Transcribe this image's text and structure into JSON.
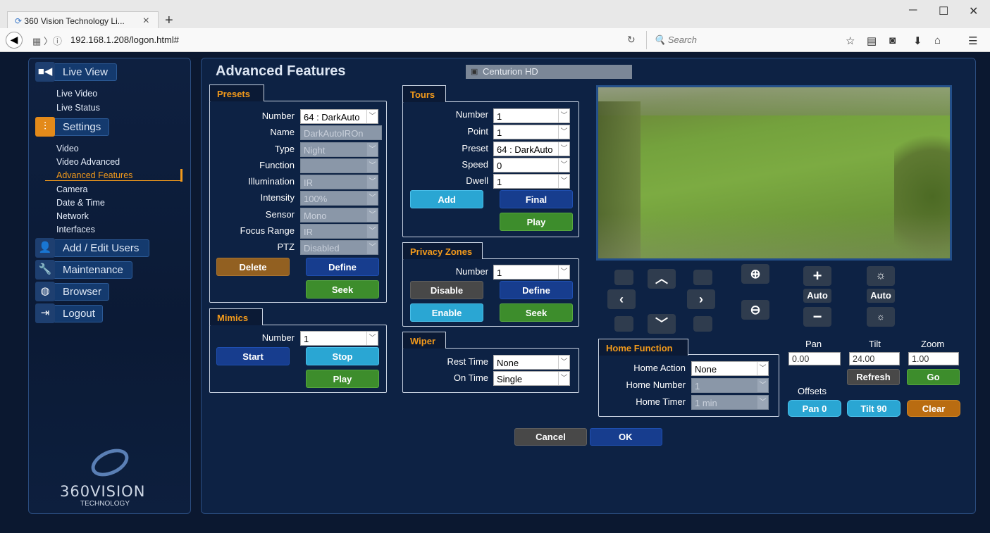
{
  "browser": {
    "tab_title": "360 Vision Technology Li...",
    "url": "192.168.1.208/logon.html#",
    "search_placeholder": "Search"
  },
  "sidebar": {
    "live_view": "Live View",
    "live_links": [
      "Live Video",
      "Live Status"
    ],
    "settings": "Settings",
    "settings_links": [
      "Video",
      "Video Advanced",
      "Advanced Features",
      "Camera",
      "Date & Time",
      "Network",
      "Interfaces"
    ],
    "add_users": "Add / Edit Users",
    "maintenance": "Maintenance",
    "browser": "Browser",
    "logout": "Logout",
    "logo_line1": "360VISION",
    "logo_line2": "TECHNOLOGY"
  },
  "main": {
    "title": "Advanced Features",
    "camera_name": "Centurion HD",
    "presets": {
      "tab": "Presets",
      "number_label": "Number",
      "number": "64 : DarkAuto",
      "name_label": "Name",
      "name": "DarkAutoIROn",
      "type_label": "Type",
      "type": "Night",
      "function_label": "Function",
      "function": "",
      "illumination_label": "Illumination",
      "illumination": "IR",
      "intensity_label": "Intensity",
      "intensity": "100%",
      "sensor_label": "Sensor",
      "sensor": "Mono",
      "focus_label": "Focus Range",
      "focus": "IR",
      "ptz_label": "PTZ",
      "ptz": "Disabled",
      "delete": "Delete",
      "define": "Define",
      "seek": "Seek"
    },
    "mimics": {
      "tab": "Mimics",
      "number_label": "Number",
      "number": "1",
      "start": "Start",
      "stop": "Stop",
      "play": "Play"
    },
    "tours": {
      "tab": "Tours",
      "number_label": "Number",
      "number": "1",
      "point_label": "Point",
      "point": "1",
      "preset_label": "Preset",
      "preset": "64 : DarkAuto",
      "speed_label": "Speed",
      "speed": "0",
      "dwell_label": "Dwell",
      "dwell": "1",
      "add": "Add",
      "final": "Final",
      "play": "Play"
    },
    "privacy": {
      "tab": "Privacy Zones",
      "number_label": "Number",
      "number": "1",
      "disable": "Disable",
      "define": "Define",
      "enable": "Enable",
      "seek": "Seek"
    },
    "wiper": {
      "tab": "Wiper",
      "rest_label": "Rest Time",
      "rest": "None",
      "on_label": "On Time",
      "on": "Single"
    },
    "home": {
      "tab": "Home Function",
      "action_label": "Home Action",
      "action": "None",
      "number_label": "Home Number",
      "number": "1",
      "timer_label": "Home Timer",
      "timer": "1 min"
    },
    "ptz": {
      "auto_focus": "Auto",
      "auto_iris": "Auto",
      "pan_label": "Pan",
      "tilt_label": "Tilt",
      "zoom_label": "Zoom",
      "pan": "0.00",
      "tilt": "24.00",
      "zoom": "1.00",
      "refresh": "Refresh",
      "go": "Go",
      "offsets_label": "Offsets",
      "pan0": "Pan 0",
      "tilt90": "Tilt 90",
      "clear": "Clear"
    },
    "cancel": "Cancel",
    "ok": "OK"
  }
}
